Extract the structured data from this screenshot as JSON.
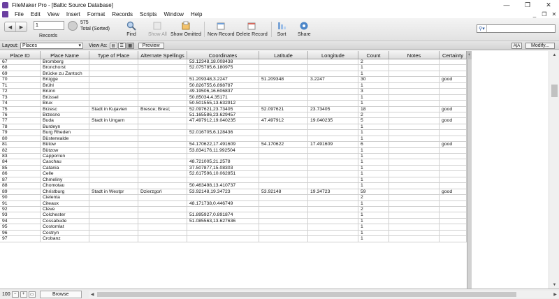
{
  "window": {
    "title": "FileMaker Pro - [Baltic Source Database]",
    "controls": [
      "—",
      "❐",
      "✕"
    ]
  },
  "menu": {
    "items": [
      "File",
      "Edit",
      "View",
      "Insert",
      "Format",
      "Records",
      "Scripts",
      "Window",
      "Help"
    ],
    "mdi_controls": [
      "_",
      "❐",
      "✕"
    ]
  },
  "toolbar": {
    "record_number": "1",
    "records_label": "Records",
    "total_count": "575",
    "total_label": "Total (Sorted)",
    "find_label": "Find",
    "show_all_label": "Show All",
    "show_omitted_label": "Show Omitted",
    "new_record_label": "New Record",
    "delete_record_label": "Delete Record",
    "sort_label": "Sort",
    "share_label": "Share",
    "quickfind_placeholder": ""
  },
  "layoutbar": {
    "layout_label": "Layout:",
    "layout_value": "Places",
    "view_as_label": "View As:",
    "preview_label": "Preview",
    "aa_label": "A|A",
    "modify_label": "Modify..."
  },
  "table": {
    "headers": [
      "Place ID",
      "Place Name",
      "Type of Place",
      "Alternate Spellings",
      "Coordinates",
      "Latitude",
      "Longitude",
      "Count",
      "Notes",
      "Certainty"
    ],
    "rows": [
      [
        "67",
        "Bromberg",
        "",
        "",
        "53.12348,18.008438",
        "",
        "",
        "2",
        "",
        ""
      ],
      [
        "68",
        "Bronchorst",
        "",
        "",
        "52.075785,6.180975",
        "",
        "",
        "1",
        "",
        ""
      ],
      [
        "69",
        "Brücke zu Zantoch",
        "",
        "",
        "",
        "",
        "",
        "1",
        "",
        ""
      ],
      [
        "70",
        "Brügge",
        "",
        "",
        "51.209348,3.2247",
        "51.209348",
        "3.2247",
        "30",
        "",
        "good"
      ],
      [
        "71",
        "Brühl",
        "",
        "",
        "50.826755,6.898787",
        "",
        "",
        "1",
        "",
        ""
      ],
      [
        "72",
        "Brünn",
        "",
        "",
        "49.19506,16.606837",
        "",
        "",
        "3",
        "",
        ""
      ],
      [
        "73",
        "Brüssel",
        "",
        "",
        "50.85034,4.35171",
        "",
        "",
        "1",
        "",
        ""
      ],
      [
        "74",
        "Brux",
        "",
        "",
        "50.501555,13.632912",
        "",
        "",
        "1",
        "",
        ""
      ],
      [
        "75",
        "Brzesc",
        "Stadt in Kujavien",
        "Bresce; Brest;",
        "52.097621,23.73405",
        "52.097621",
        "23.73405",
        "18",
        "",
        "good"
      ],
      [
        "76",
        "Brzesno",
        "",
        "",
        "51.165586,23.629457",
        "",
        "",
        "2",
        "",
        ""
      ],
      [
        "77",
        "Buda",
        "Stadt in Ungarn",
        "",
        "47.497912,19.040235",
        "47.497912",
        "19.040235",
        "5",
        "",
        "good"
      ],
      [
        "78",
        "Burdeyn",
        "",
        "",
        "",
        "",
        "",
        "1",
        "",
        ""
      ],
      [
        "79",
        "Burg Rheden",
        "",
        "",
        "52.016705,6.128436",
        "",
        "",
        "1",
        "",
        ""
      ],
      [
        "80",
        "Büsterwalde",
        "",
        "",
        "",
        "",
        "",
        "1",
        "",
        ""
      ],
      [
        "81",
        "Bütow",
        "",
        "",
        "54.170622,17.491609",
        "54.170622",
        "17.491609",
        "6",
        "",
        "good"
      ],
      [
        "82",
        "Bützow",
        "",
        "",
        "53.834176,11.992504",
        "",
        "",
        "1",
        "",
        ""
      ],
      [
        "83",
        "Capporren",
        "",
        "",
        "",
        "",
        "",
        "1",
        "",
        ""
      ],
      [
        "84",
        "Caschau",
        "",
        "",
        "48.721005,21.2578",
        "",
        "",
        "1",
        "",
        ""
      ],
      [
        "85",
        "Catania",
        "",
        "",
        "37.507877,15.08303",
        "",
        "",
        "1",
        "",
        ""
      ],
      [
        "86",
        "Celle",
        "",
        "",
        "52.617596,10.062851",
        "",
        "",
        "1",
        "",
        ""
      ],
      [
        "87",
        "Chmeliny",
        "",
        "",
        "",
        "",
        "",
        "1",
        "",
        ""
      ],
      [
        "88",
        "Chomotau",
        "",
        "",
        "50.463498,13.410737",
        "",
        "",
        "1",
        "",
        ""
      ],
      [
        "89",
        "Christburg",
        "Stadt in Westpr",
        "Dzierzgoń",
        "53.92148,19.34723",
        "53.92148",
        "19.34723",
        "59",
        "",
        "good"
      ],
      [
        "90",
        "Cielenta",
        "",
        "",
        "",
        "",
        "",
        "2",
        "",
        ""
      ],
      [
        "91",
        "Citeaux",
        "",
        "",
        "48.171738,0.446749",
        "",
        "",
        "1",
        "",
        ""
      ],
      [
        "92",
        "Cleve",
        "",
        "",
        "",
        "",
        "",
        "2",
        "",
        ""
      ],
      [
        "93",
        "Colchester",
        "",
        "",
        "51.895927,0.891874",
        "",
        "",
        "1",
        "",
        ""
      ],
      [
        "94",
        "Cossabude",
        "",
        "",
        "51.085563,13.627636",
        "",
        "",
        "1",
        "",
        ""
      ],
      [
        "95",
        "Costomlat",
        "",
        "",
        "",
        "",
        "",
        "1",
        "",
        ""
      ],
      [
        "96",
        "Costryn",
        "",
        "",
        "",
        "",
        "",
        "1",
        "",
        ""
      ],
      [
        "97",
        "Crobanz",
        "",
        "",
        "",
        "",
        "",
        "1",
        "",
        ""
      ]
    ]
  },
  "statusbar": {
    "zoom": "100",
    "mode": "Browse"
  }
}
